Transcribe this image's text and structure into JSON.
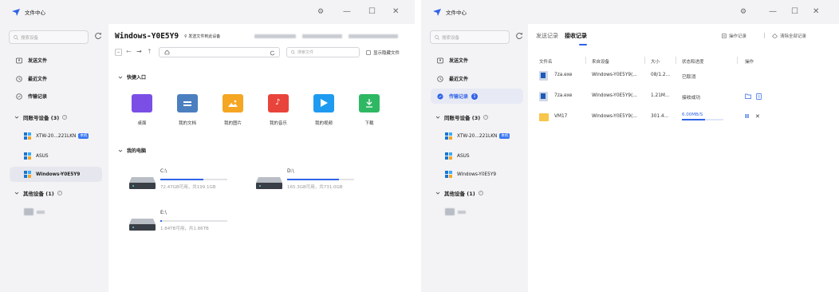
{
  "left_window": {
    "title": "文件中心",
    "controls": {
      "settings": "⚙",
      "minimize": "—",
      "maximize": "☐",
      "close": "✕"
    },
    "search_placeholder": "搜索设备",
    "nav": [
      {
        "label": "发送文件"
      },
      {
        "label": "最近文件"
      },
      {
        "label": "传输记录"
      }
    ],
    "group_label": "同账号设备 (3)",
    "devices": [
      {
        "label": "XTW-20...221LKN",
        "badge": "本机"
      },
      {
        "label": "ASUS"
      },
      {
        "label": "Windows-Y0E5Y9"
      }
    ],
    "other_group_label": "其他设备 (1)",
    "device_title": "Windows-Y0E5Y9",
    "device_subtitle": "⚲ 发送文件到此设备",
    "file_search_placeholder": "搜索文件",
    "show_hidden_label": "显示隐藏文件",
    "quick_access_label": "快捷入口",
    "quick_access": [
      {
        "label": "桌面",
        "color": "#7b4fe6"
      },
      {
        "label": "我的文档",
        "color": "#4b7fbf"
      },
      {
        "label": "我的图片",
        "color": "#f5a623"
      },
      {
        "label": "我的音乐",
        "color": "#e8443b"
      },
      {
        "label": "我的视频",
        "color": "#1e9bf0"
      },
      {
        "label": "下载",
        "color": "#2fb863"
      }
    ],
    "my_computer_label": "我的电脑",
    "drives": [
      {
        "name": "C:\\",
        "free": "72.47GB可用，共199.1GB",
        "used_fraction": 0.64
      },
      {
        "name": "D:\\",
        "free": "165.3GB可用，共731.0GB",
        "used_fraction": 0.77
      },
      {
        "name": "E:\\",
        "free": "1.84TB可用，共1.86TB",
        "used_fraction": 0.02
      }
    ]
  },
  "right_window": {
    "title": "文件中心",
    "controls": {
      "settings": "⚙",
      "minimize": "—",
      "maximize": "☐",
      "close": "✕"
    },
    "search_placeholder": "搜索设备",
    "nav": [
      {
        "label": "发送文件"
      },
      {
        "label": "最近文件"
      },
      {
        "label": "传输记录",
        "badge": "1"
      }
    ],
    "group_label": "同账号设备 (3)",
    "devices": [
      {
        "label": "XTW-20...221LKN",
        "badge": "本机"
      },
      {
        "label": "ASUS"
      },
      {
        "label": "Windows-Y0E5Y9"
      }
    ],
    "other_group_label": "其他设备 (1)",
    "tabs": {
      "send": "发送记录",
      "receive": "接收记录"
    },
    "actions": {
      "log": "操作记录",
      "clear": "清除全部记录"
    },
    "columns": {
      "name": "文件名",
      "source": "来自设备",
      "size": "大小",
      "status": "状态和进度",
      "ops": "操作"
    },
    "rows": [
      {
        "name": "7za.exe",
        "source": "Windows-Y0E5Y9(...",
        "size": "08/1.2...",
        "status": "已取消"
      },
      {
        "name": "7za.exe",
        "source": "Windows-Y0E5Y9(...",
        "size": "1.21M...",
        "status": "接收成功"
      },
      {
        "name": "VM17",
        "source": "Windows-Y0E5Y9(...",
        "size": "301.4...",
        "status": "6.00MB/S",
        "progress": 0.55
      }
    ]
  }
}
